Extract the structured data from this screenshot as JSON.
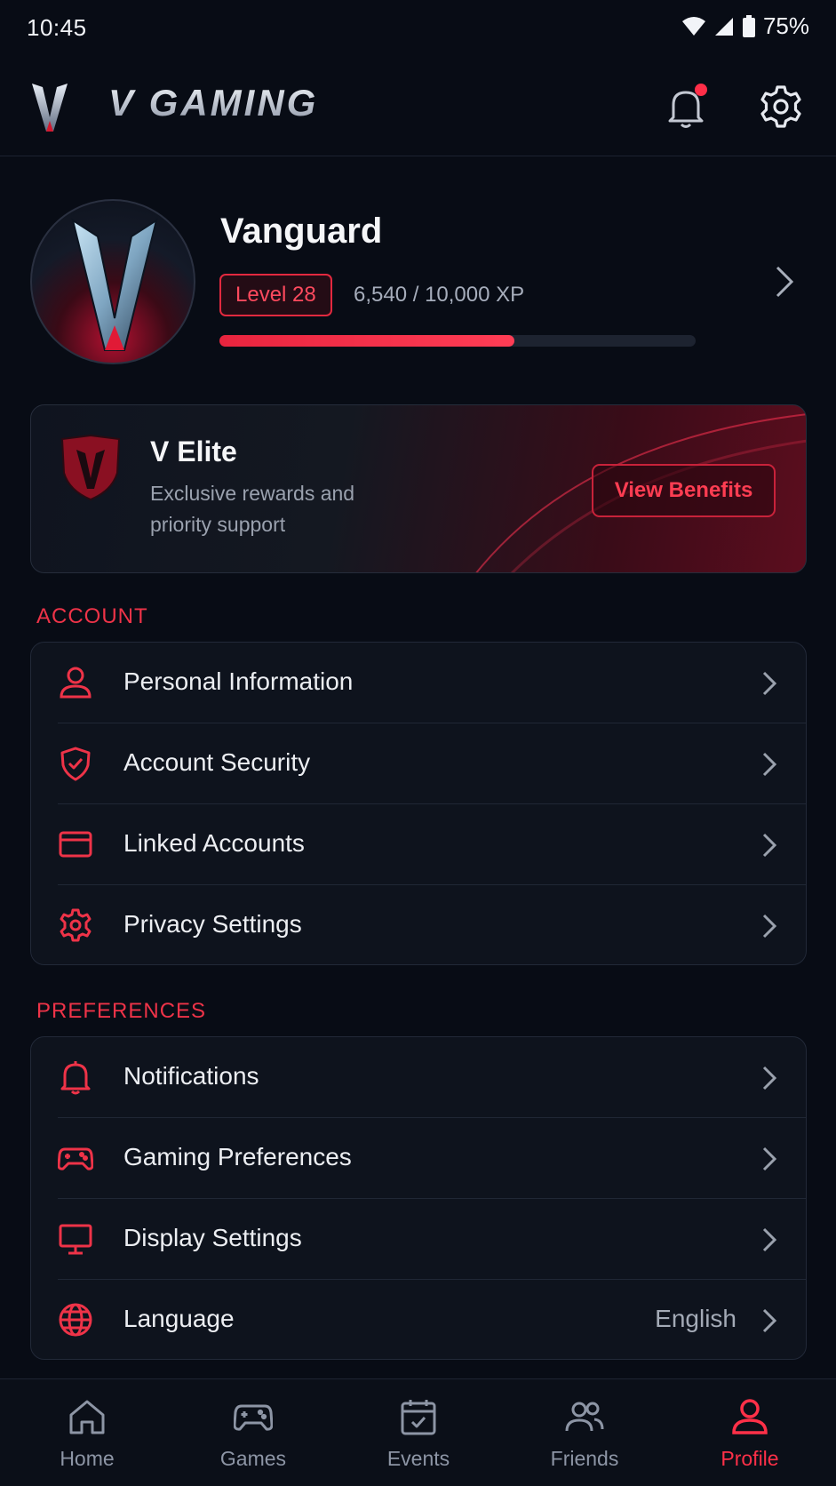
{
  "status_bar": {
    "time": "10:45",
    "battery": "75%"
  },
  "header": {
    "brand": "V GAMING"
  },
  "profile": {
    "name": "Vanguard",
    "level": "Level 28",
    "xp_text": "6,540 / 10,000 XP",
    "xp_progress": 0.62
  },
  "elite": {
    "title": "V Elite",
    "description": "Exclusive rewards and priority support",
    "button": "View Benefits"
  },
  "account": {
    "title": "ACCOUNT",
    "items": [
      {
        "label": "Personal Information",
        "icon": "person-icon"
      },
      {
        "label": "Account Security",
        "icon": "shield-check-icon"
      },
      {
        "label": "Linked Accounts",
        "icon": "credit-card-icon"
      },
      {
        "label": "Privacy Settings",
        "icon": "gear-icon"
      }
    ]
  },
  "preferences": {
    "title": "PREFERENCES",
    "items": [
      {
        "label": "Notifications",
        "icon": "bell-icon"
      },
      {
        "label": "Gaming Preferences",
        "icon": "gamepad-icon"
      },
      {
        "label": "Display Settings",
        "icon": "monitor-icon"
      },
      {
        "label": "Language",
        "icon": "globe-icon",
        "value": "English"
      }
    ]
  },
  "nav": {
    "items": [
      {
        "label": "Home",
        "icon": "home-icon"
      },
      {
        "label": "Games",
        "icon": "gamepad-icon"
      },
      {
        "label": "Events",
        "icon": "calendar-icon"
      },
      {
        "label": "Friends",
        "icon": "friends-icon"
      },
      {
        "label": "Profile",
        "icon": "person-icon",
        "active": true
      }
    ]
  },
  "colors": {
    "accent": "#ee3348",
    "background": "#080c15",
    "card": "#0e131d"
  }
}
